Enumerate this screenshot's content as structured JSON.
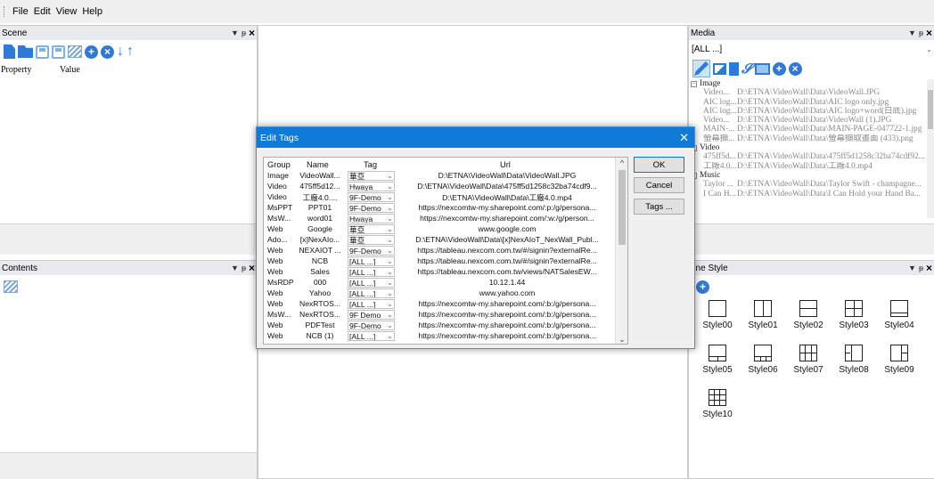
{
  "menu": {
    "items": [
      "File",
      "Edit",
      "View",
      "Help"
    ]
  },
  "scene_panel": {
    "title": "Scene",
    "columns": {
      "property": "Property",
      "value": "Value"
    },
    "icons": [
      "rect-icon",
      "folder-icon",
      "save-icon",
      "save-as-icon",
      "clapper-icon",
      "add-icon",
      "remove-icon",
      "move-down-icon",
      "move-up-icon"
    ]
  },
  "contents_panel": {
    "title": "Contents"
  },
  "media_panel": {
    "title": "Media",
    "filter": "[ALL ...]",
    "groups": [
      {
        "label": "Image",
        "items": [
          {
            "name": "Video...",
            "path": "D:\\ETNA\\VideoWall\\Data\\VideoWall.JPG"
          },
          {
            "name": "AIC log...",
            "path": "D:\\ETNA\\VideoWall\\Data\\AIC logo only.jpg"
          },
          {
            "name": "AIC log...",
            "path": "D:\\ETNA\\VideoWall\\Data\\AIC logo+word(白底).jpg"
          },
          {
            "name": "Video...",
            "path": "D:\\ETNA\\VideoWall\\Data\\VideoWall (1).JPG"
          },
          {
            "name": "MAIN-...",
            "path": "D:\\ETNA\\VideoWall\\Data\\MAIN-PAGE-047722-1.jpg"
          },
          {
            "name": "螢幕擷...",
            "path": "D:\\ETNA\\VideoWall\\Data\\螢幕擷取畫面 (433).png"
          }
        ]
      },
      {
        "label": "Video",
        "items": [
          {
            "name": "475ff5d...",
            "path": "D:\\ETNA\\VideoWall\\Data\\475ff5d1258c32ba74cdf92..."
          },
          {
            "name": "工廠4.0...",
            "path": "D:\\ETNA\\VideoWall\\Data\\工廠4.0.mp4"
          }
        ]
      },
      {
        "label": "Music",
        "items": [
          {
            "name": "Taylor ...",
            "path": "D:\\ETNA\\VideoWall\\Data\\Taylor Swift - champagne..."
          },
          {
            "name": "I Can H...",
            "path": "D:\\ETNA\\VideoWall\\Data\\I Can Hold your Hand Ba..."
          }
        ]
      }
    ]
  },
  "scene_style_panel": {
    "title": "ene Style",
    "styles": [
      "Style00",
      "Style01",
      "Style02",
      "Style03",
      "Style04",
      "Style05",
      "Style06",
      "Style07",
      "Style08",
      "Style09",
      "Style10"
    ]
  },
  "dialog": {
    "title": "Edit Tags",
    "close": "✕",
    "columns": {
      "group": "Group",
      "name": "Name",
      "tag": "Tag",
      "url": "Url"
    },
    "rows": [
      {
        "group": "Image",
        "name": "VideoWall...",
        "tag": "華亞",
        "url": "D:\\ETNA\\VideoWall\\Data\\VideoWall.JPG"
      },
      {
        "group": "Video",
        "name": "475ff5d12...",
        "tag": "Hwaya",
        "url": "D:\\ETNA\\VideoWall\\Data\\475ff5d1258c32ba74cdf9..."
      },
      {
        "group": "Video",
        "name": "工廠4.0....",
        "tag": "9F-Demo",
        "url": "D:\\ETNA\\VideoWall\\Data\\工廠4.0.mp4"
      },
      {
        "group": "MsPPT",
        "name": "PPT01",
        "tag": "9F-Demo",
        "url": "https://nexcomtw-my.sharepoint.com/:p:/g/persona..."
      },
      {
        "group": "MsW...",
        "name": "word01",
        "tag": "Hwaya",
        "url": "https://nexcomtw-my.sharepoint.com/:w:/g/person..."
      },
      {
        "group": "Web",
        "name": "Google",
        "tag": "華亞",
        "url": "www.google.com"
      },
      {
        "group": "Ado...",
        "name": "[x]NexAIo...",
        "tag": "華亞",
        "url": "D:\\ETNA\\VideoWall\\Data\\[x]NexAIoT_NexWall_Publ..."
      },
      {
        "group": "Web",
        "name": "NEXAIOT ...",
        "tag": "9F-Demo",
        "url": "https://tableau.nexcom.com.tw/#/signin?externalRe..."
      },
      {
        "group": "Web",
        "name": "NCB",
        "tag": "[ALL ...]",
        "url": "https://tableau.nexcom.com.tw/#/signin?externalRe..."
      },
      {
        "group": "Web",
        "name": "Sales",
        "tag": "[ALL ...]",
        "url": "https://tableau.nexcom.com.tw/views/NATSalesEW..."
      },
      {
        "group": "MsRDP",
        "name": "000",
        "tag": "[ALL ...]",
        "url": "10.12.1.44"
      },
      {
        "group": "Web",
        "name": "Yahoo",
        "tag": "[ALL ...]",
        "url": "www.yahoo.com"
      },
      {
        "group": "Web",
        "name": "NexRTOS...",
        "tag": "[ALL ...]",
        "url": "https://nexcomtw-my.sharepoint.com/:b:/g/persona..."
      },
      {
        "group": "MsW...",
        "name": "NexRTOS...",
        "tag": "9F Demo",
        "url": "https://nexcomtw-my.sharepoint.com/:b:/g/persona..."
      },
      {
        "group": "Web",
        "name": "PDFTest",
        "tag": "9F-Demo",
        "url": "https://nexcomtw-my.sharepoint.com/:b:/g/persona..."
      },
      {
        "group": "Web",
        "name": "NCB (1)",
        "tag": "[ALL ...]",
        "url": "https://nexcomtw-my.sharepoint.com/:b:/g/persona..."
      }
    ],
    "buttons": {
      "ok": "OK",
      "cancel": "Cancel",
      "tags": "Tags ..."
    }
  }
}
